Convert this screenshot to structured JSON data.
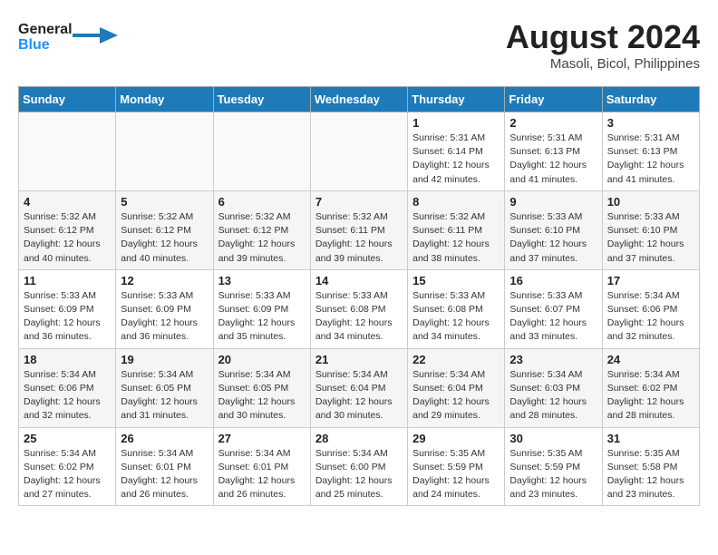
{
  "header": {
    "logo_general": "General",
    "logo_blue": "Blue",
    "month_year": "August 2024",
    "location": "Masoli, Bicol, Philippines"
  },
  "weekdays": [
    "Sunday",
    "Monday",
    "Tuesday",
    "Wednesday",
    "Thursday",
    "Friday",
    "Saturday"
  ],
  "weeks": [
    [
      {
        "day": "",
        "info": ""
      },
      {
        "day": "",
        "info": ""
      },
      {
        "day": "",
        "info": ""
      },
      {
        "day": "",
        "info": ""
      },
      {
        "day": "1",
        "info": "Sunrise: 5:31 AM\nSunset: 6:14 PM\nDaylight: 12 hours\nand 42 minutes."
      },
      {
        "day": "2",
        "info": "Sunrise: 5:31 AM\nSunset: 6:13 PM\nDaylight: 12 hours\nand 41 minutes."
      },
      {
        "day": "3",
        "info": "Sunrise: 5:31 AM\nSunset: 6:13 PM\nDaylight: 12 hours\nand 41 minutes."
      }
    ],
    [
      {
        "day": "4",
        "info": "Sunrise: 5:32 AM\nSunset: 6:12 PM\nDaylight: 12 hours\nand 40 minutes."
      },
      {
        "day": "5",
        "info": "Sunrise: 5:32 AM\nSunset: 6:12 PM\nDaylight: 12 hours\nand 40 minutes."
      },
      {
        "day": "6",
        "info": "Sunrise: 5:32 AM\nSunset: 6:12 PM\nDaylight: 12 hours\nand 39 minutes."
      },
      {
        "day": "7",
        "info": "Sunrise: 5:32 AM\nSunset: 6:11 PM\nDaylight: 12 hours\nand 39 minutes."
      },
      {
        "day": "8",
        "info": "Sunrise: 5:32 AM\nSunset: 6:11 PM\nDaylight: 12 hours\nand 38 minutes."
      },
      {
        "day": "9",
        "info": "Sunrise: 5:33 AM\nSunset: 6:10 PM\nDaylight: 12 hours\nand 37 minutes."
      },
      {
        "day": "10",
        "info": "Sunrise: 5:33 AM\nSunset: 6:10 PM\nDaylight: 12 hours\nand 37 minutes."
      }
    ],
    [
      {
        "day": "11",
        "info": "Sunrise: 5:33 AM\nSunset: 6:09 PM\nDaylight: 12 hours\nand 36 minutes."
      },
      {
        "day": "12",
        "info": "Sunrise: 5:33 AM\nSunset: 6:09 PM\nDaylight: 12 hours\nand 36 minutes."
      },
      {
        "day": "13",
        "info": "Sunrise: 5:33 AM\nSunset: 6:09 PM\nDaylight: 12 hours\nand 35 minutes."
      },
      {
        "day": "14",
        "info": "Sunrise: 5:33 AM\nSunset: 6:08 PM\nDaylight: 12 hours\nand 34 minutes."
      },
      {
        "day": "15",
        "info": "Sunrise: 5:33 AM\nSunset: 6:08 PM\nDaylight: 12 hours\nand 34 minutes."
      },
      {
        "day": "16",
        "info": "Sunrise: 5:33 AM\nSunset: 6:07 PM\nDaylight: 12 hours\nand 33 minutes."
      },
      {
        "day": "17",
        "info": "Sunrise: 5:34 AM\nSunset: 6:06 PM\nDaylight: 12 hours\nand 32 minutes."
      }
    ],
    [
      {
        "day": "18",
        "info": "Sunrise: 5:34 AM\nSunset: 6:06 PM\nDaylight: 12 hours\nand 32 minutes."
      },
      {
        "day": "19",
        "info": "Sunrise: 5:34 AM\nSunset: 6:05 PM\nDaylight: 12 hours\nand 31 minutes."
      },
      {
        "day": "20",
        "info": "Sunrise: 5:34 AM\nSunset: 6:05 PM\nDaylight: 12 hours\nand 30 minutes."
      },
      {
        "day": "21",
        "info": "Sunrise: 5:34 AM\nSunset: 6:04 PM\nDaylight: 12 hours\nand 30 minutes."
      },
      {
        "day": "22",
        "info": "Sunrise: 5:34 AM\nSunset: 6:04 PM\nDaylight: 12 hours\nand 29 minutes."
      },
      {
        "day": "23",
        "info": "Sunrise: 5:34 AM\nSunset: 6:03 PM\nDaylight: 12 hours\nand 28 minutes."
      },
      {
        "day": "24",
        "info": "Sunrise: 5:34 AM\nSunset: 6:02 PM\nDaylight: 12 hours\nand 28 minutes."
      }
    ],
    [
      {
        "day": "25",
        "info": "Sunrise: 5:34 AM\nSunset: 6:02 PM\nDaylight: 12 hours\nand 27 minutes."
      },
      {
        "day": "26",
        "info": "Sunrise: 5:34 AM\nSunset: 6:01 PM\nDaylight: 12 hours\nand 26 minutes."
      },
      {
        "day": "27",
        "info": "Sunrise: 5:34 AM\nSunset: 6:01 PM\nDaylight: 12 hours\nand 26 minutes."
      },
      {
        "day": "28",
        "info": "Sunrise: 5:34 AM\nSunset: 6:00 PM\nDaylight: 12 hours\nand 25 minutes."
      },
      {
        "day": "29",
        "info": "Sunrise: 5:35 AM\nSunset: 5:59 PM\nDaylight: 12 hours\nand 24 minutes."
      },
      {
        "day": "30",
        "info": "Sunrise: 5:35 AM\nSunset: 5:59 PM\nDaylight: 12 hours\nand 23 minutes."
      },
      {
        "day": "31",
        "info": "Sunrise: 5:35 AM\nSunset: 5:58 PM\nDaylight: 12 hours\nand 23 minutes."
      }
    ]
  ]
}
